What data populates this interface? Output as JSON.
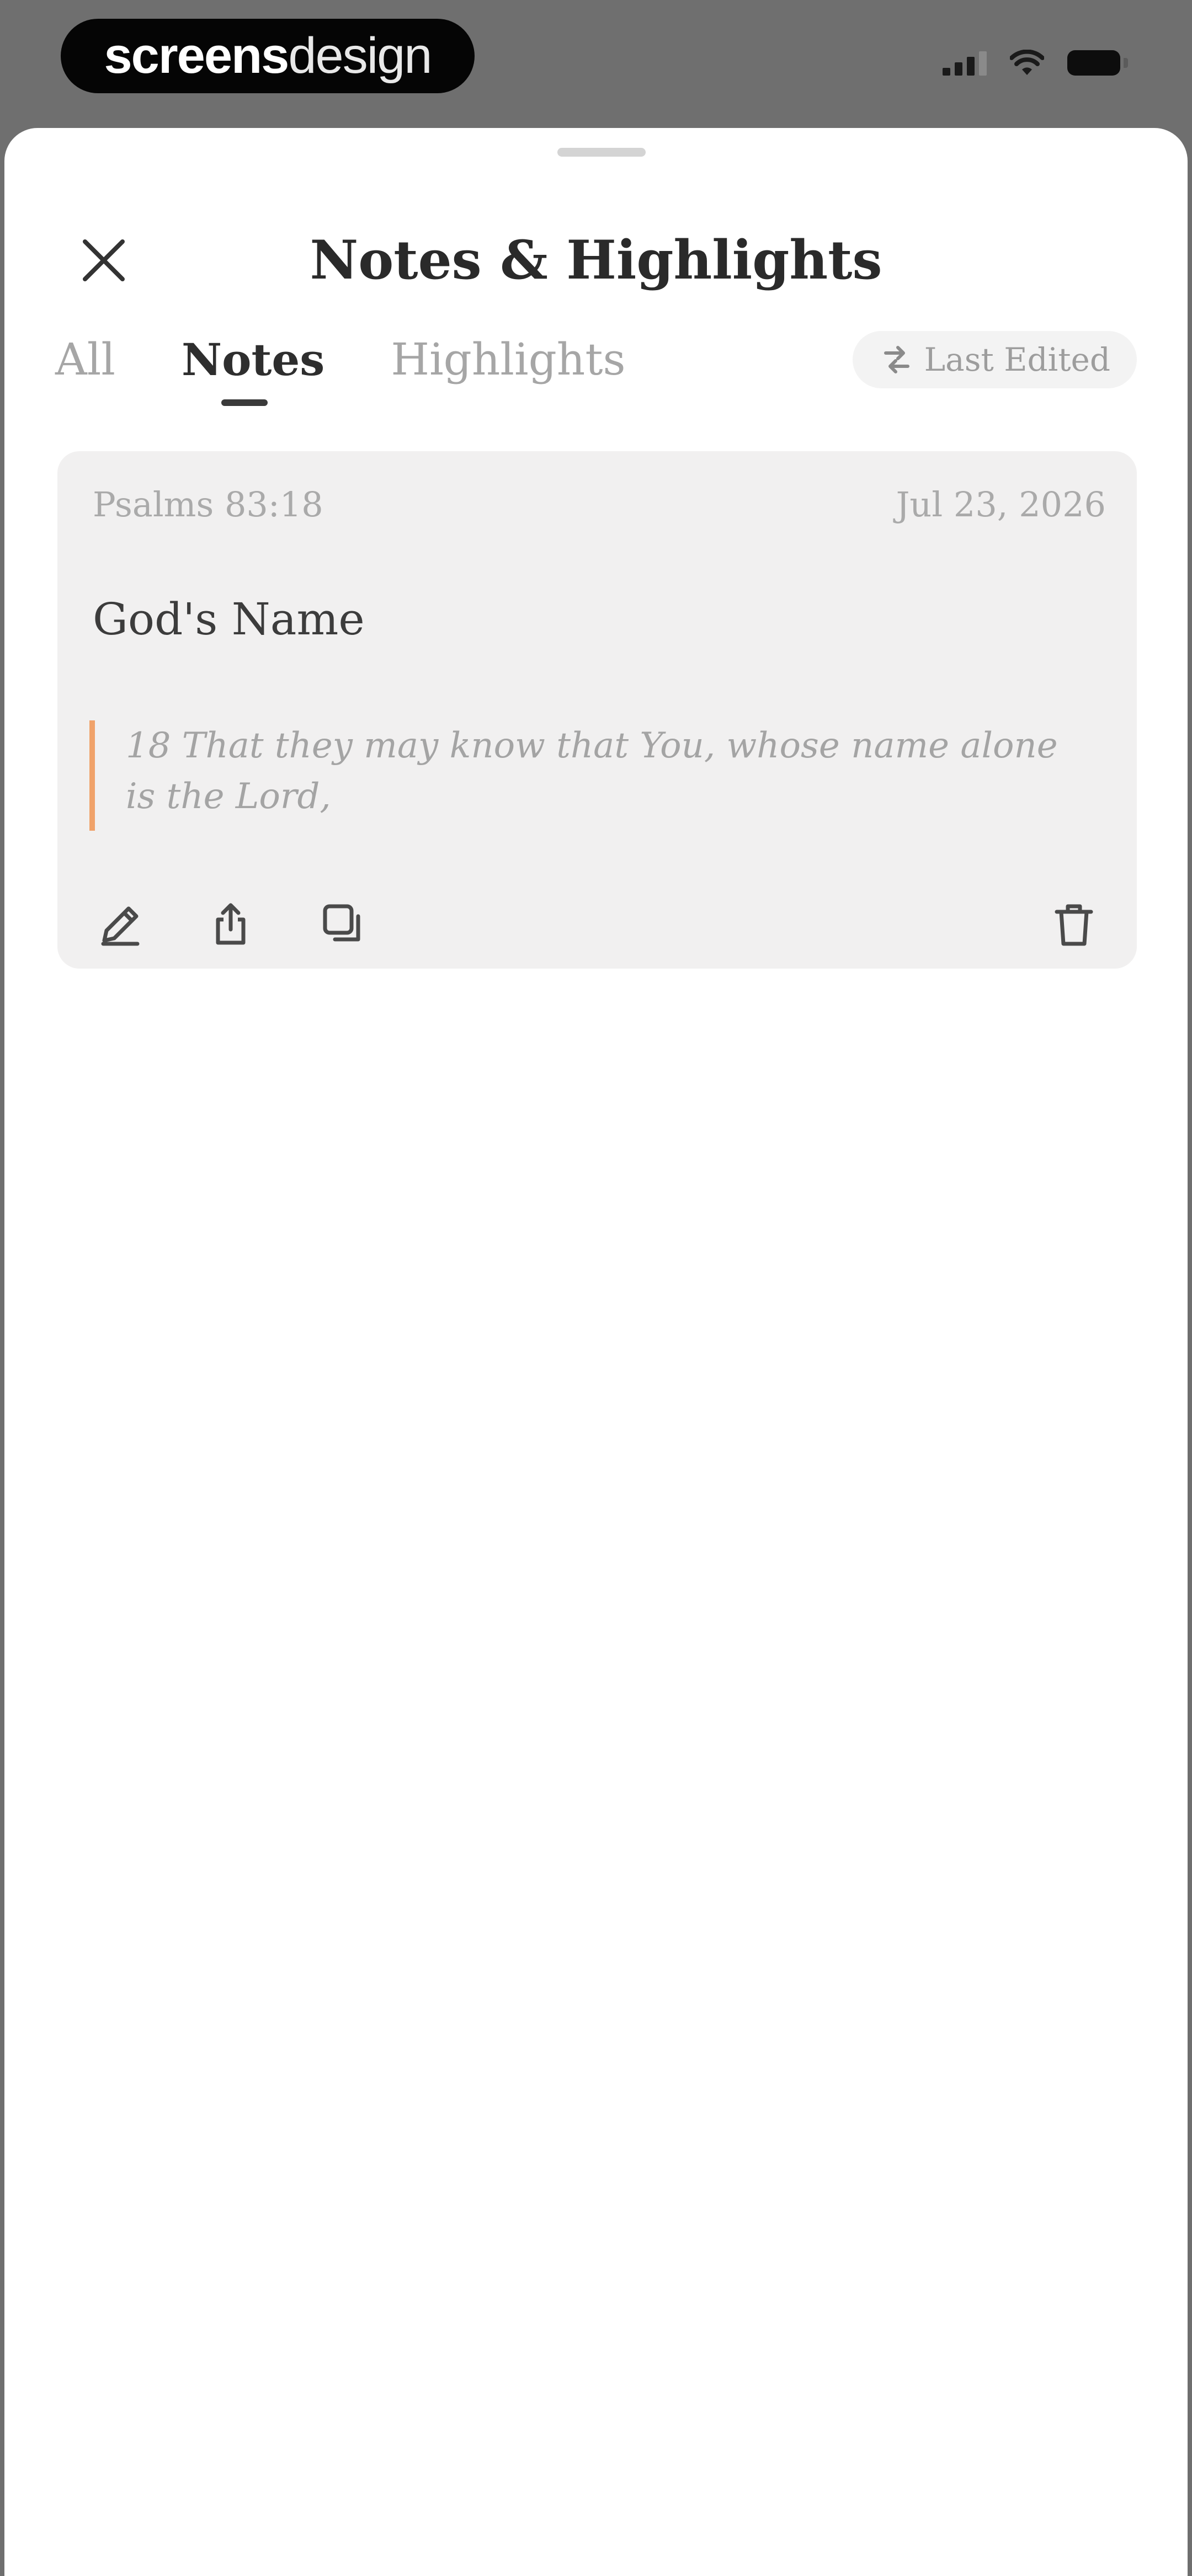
{
  "status_bar": {
    "brand_bold": "screens",
    "brand_light": "design"
  },
  "sheet": {
    "title": "Notes & Highlights",
    "tabs": [
      {
        "label": "All",
        "selected": false
      },
      {
        "label": "Notes",
        "selected": true
      },
      {
        "label": "Highlights",
        "selected": false
      }
    ],
    "sort_label": "Last Edited"
  },
  "note": {
    "reference": "Psalms 83:18",
    "date": "Jul 23, 2026",
    "title": "God's Name",
    "quote": "18 That they may know that You, whose name alone is the Lord,",
    "accent_color": "#f0a26a"
  },
  "icons": [
    "close-icon",
    "sort-icon",
    "pencil-icon",
    "share-icon",
    "copy-icon",
    "trash-icon"
  ]
}
